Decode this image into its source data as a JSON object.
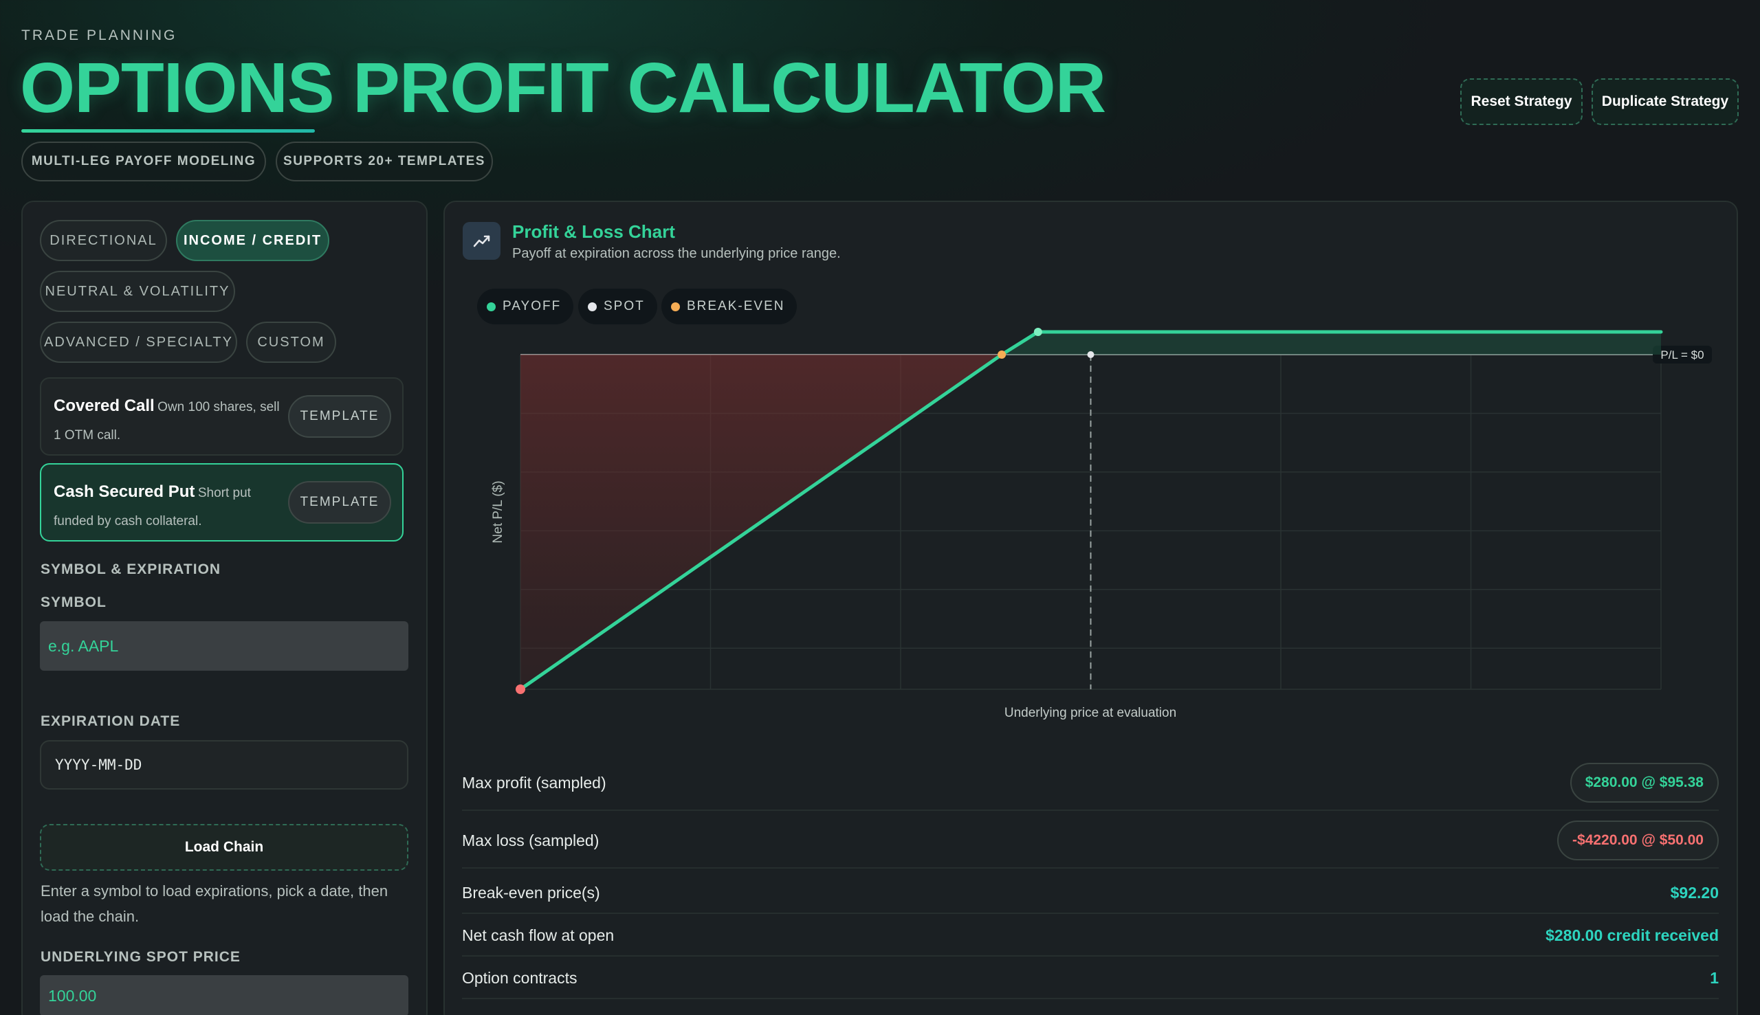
{
  "header": {
    "eyebrow": "TRADE PLANNING",
    "title": "OPTIONS PROFIT CALCULATOR",
    "tags": [
      "MULTI-LEG PAYOFF MODELING",
      "SUPPORTS 20+ TEMPLATES"
    ],
    "reset_label": "Reset Strategy",
    "duplicate_label": "Duplicate Strategy"
  },
  "sidebar": {
    "categories": [
      {
        "label": "DIRECTIONAL",
        "active": false
      },
      {
        "label": "INCOME / CREDIT",
        "active": true
      },
      {
        "label": "NEUTRAL & VOLATILITY",
        "active": false
      },
      {
        "label": "ADVANCED / SPECIALTY",
        "active": false
      },
      {
        "label": "CUSTOM",
        "active": false
      }
    ],
    "strategies": [
      {
        "name": "Covered Call",
        "desc": "Own 100 shares, sell 1 OTM call.",
        "button": "TEMPLATE",
        "active": false
      },
      {
        "name": "Cash Secured Put",
        "desc": "Short put funded by cash collateral.",
        "button": "TEMPLATE",
        "active": true
      }
    ],
    "section_title": "SYMBOL & EXPIRATION",
    "symbol_label": "SYMBOL",
    "symbol_placeholder": "e.g. AAPL",
    "expiration_label": "EXPIRATION DATE",
    "expiration_placeholder": "YYYY-MM-DD",
    "load_label": "Load Chain",
    "help": "Enter a symbol to load expirations, pick a date, then load the chain.",
    "spot_label": "UNDERLYING SPOT PRICE",
    "spot_value": "100.00"
  },
  "chart": {
    "title": "Profit & Loss Chart",
    "subtitle": "Payoff at expiration across the underlying price range.",
    "legend": [
      {
        "label": "PAYOFF",
        "color": "#34d399"
      },
      {
        "label": "SPOT",
        "color": "#e5e7eb"
      },
      {
        "label": "BREAK-EVEN",
        "color": "#f6ad55"
      }
    ],
    "zero_label": "P/L = $0",
    "ylabel": "Net P/L ($)",
    "xlabel": "Underlying price at evaluation"
  },
  "chart_data": {
    "type": "line",
    "x": [
      50.0,
      92.2,
      95.38,
      150.0
    ],
    "series": [
      {
        "name": "PAYOFF",
        "values": [
          -4220,
          0,
          280,
          280
        ]
      }
    ],
    "spot": 100.0,
    "break_even": 92.2,
    "xlim": [
      50,
      150
    ],
    "ylim": [
      -4220,
      280
    ],
    "grid": true,
    "xlabel": "Underlying price at evaluation",
    "ylabel": "Net P/L ($)"
  },
  "stats": {
    "max_profit_label": "Max profit (sampled)",
    "max_profit_value": "$280.00 @ $95.38",
    "max_loss_label": "Max loss (sampled)",
    "max_loss_value": "-$4220.00 @ $50.00",
    "breakeven_label": "Break-even price(s)",
    "breakeven_value": "$92.20",
    "cashflow_label": "Net cash flow at open",
    "cashflow_value": "$280.00 credit received",
    "contracts_label": "Option contracts",
    "contracts_value": "1"
  },
  "colors": {
    "accent": "#34d399",
    "loss": "#f87171",
    "break_even": "#f6ad55"
  }
}
